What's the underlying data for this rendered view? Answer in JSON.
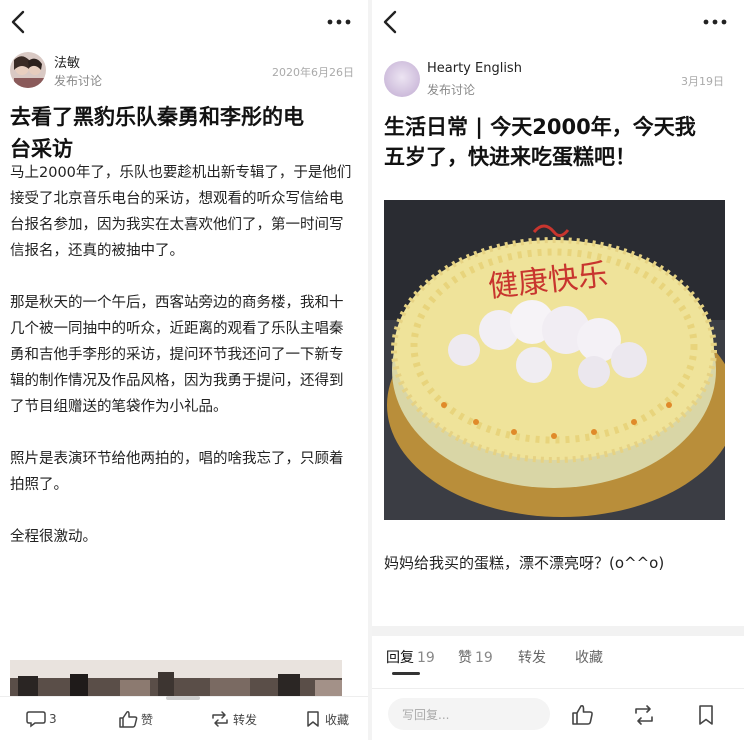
{
  "left": {
    "author_name": "法敏",
    "action": "发布讨论",
    "date": "2020年6月26日",
    "title_lines": [
      "去看了黑豹乐队秦勇和李彤的电",
      "台采访"
    ],
    "paragraphs": [
      "马上2000年了，乐队也要趁机出新专辑了，于是他们接受了北京音乐电台的采访，想观看的听众写信给电台报名参加，因为我实在太喜欢他们了，第一时间写信报名，还真的被抽中了。",
      "那是秋天的一个午后，西客站旁边的商务楼，我和十几个被一同抽中的听众，近距离的观看了乐队主唱秦勇和吉他手李彤的采访，提问环节我还问了一下新专辑的制作情况及作品风格，因为我勇于提问，还得到了节目组赠送的笔袋作为小礼品。",
      "照片是表演环节给他两拍的，唱的啥我忘了，只顾着拍照了。",
      "全程很激动。"
    ],
    "bottom_bar": {
      "comment_count": "3",
      "like_label": "赞",
      "share_label": "转发",
      "collect_label": "收藏"
    }
  },
  "right": {
    "author_name": "Hearty English",
    "action": "发布讨论",
    "date": "3月19日",
    "title_lines": [
      "生活日常 | 今天2000年，今天我",
      "五岁了，快进来吃蛋糕吧！"
    ],
    "cake_text": "健康快乐",
    "caption": "妈妈给我买的蛋糕，漂不漂亮呀？(o^^o)",
    "tabs": [
      {
        "label": "回复",
        "count": "19"
      },
      {
        "label": "赞",
        "count": "19"
      },
      {
        "label": "转发",
        "count": ""
      },
      {
        "label": "收藏",
        "count": ""
      }
    ],
    "reply_placeholder": "写回复..."
  }
}
